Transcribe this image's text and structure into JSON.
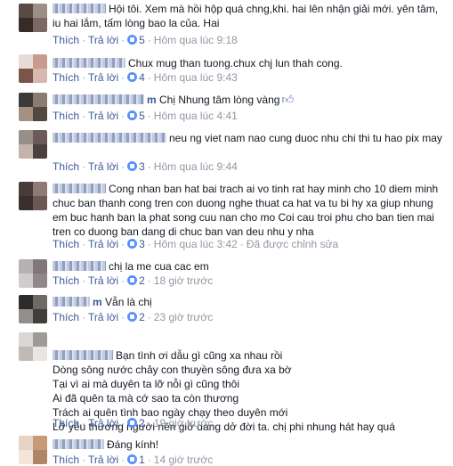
{
  "actions": {
    "like": "Thích",
    "reply": "Trả lời",
    "dot": "·"
  },
  "comments": [
    {
      "name": "",
      "text": "Hội tôi. Xem mà hồi hộp quá chng,khi. hai lên nhận giải mới. yên tâm, iu hai lắm, tấm lòng bao la của. Hai",
      "likes": "5",
      "time": "Hôm qua lúc 9:18",
      "edited": ""
    },
    {
      "name": "",
      "text": "Chux mug than tuong.chux chj lun thah cong.",
      "likes": "4",
      "time": "Hôm qua lúc 9:43",
      "edited": ""
    },
    {
      "name": "m",
      "text": "Chị Nhung tâm lòng vàng",
      "likes": "5",
      "time": "Hôm qua lúc 4:41",
      "edited": ""
    },
    {
      "name": "",
      "text": "neu ng viet nam nao cung duoc nhu chi thi tu hao pix may",
      "likes": "3",
      "time": "Hôm qua lúc 9:44",
      "edited": ""
    },
    {
      "name": "",
      "text": "Cong nhan ban hat bai trach ai vo tinh rat hay minh cho 10 diem minh chuc ban thanh cong tren con duong nghe thuat ca hat va tu bi hy xa giup nhung em buc hanh ban la phat song cuu nan cho mo Coi cau troi phu cho ban tien mai tren co duong ban dang di chuc ban van deu nhu y nha",
      "likes": "3",
      "time": "Hôm qua lúc 3:42",
      "edited": "Đã được chỉnh sửa"
    },
    {
      "name": "",
      "text": "chị la me cua cac em",
      "likes": "2",
      "time": "18 giờ trước",
      "edited": ""
    },
    {
      "name": "m",
      "text": "Vẫn là chị",
      "likes": "2",
      "time": "23 giờ trước",
      "edited": ""
    },
    {
      "name": "",
      "text": "Bạn tình ơi dẫu gì cũng xa nhau rồi\nDòng sông nước chảy con thuyền sông đưa xa bờ\nTại vì ai mà duyên ta lỡ nỗi gì cũng thôi\nAi đã quên ta mà cớ sao ta còn thương\nTrách ai quên tình bao ngày chạy theo duyên mới\nLỡ yêu thương người nên giờ dang dở đời ta. chị phi nhung hát hay quá",
      "likes": "2",
      "time": "19 giờ trước",
      "edited": ""
    },
    {
      "name": "",
      "text": "Đáng kính!",
      "likes": "1",
      "time": "14 giờ trước",
      "edited": ""
    }
  ],
  "colors": {
    "link": "#3b5998",
    "meta": "#9197a3",
    "text": "#141823",
    "like": "#5890ff"
  },
  "icons": {
    "like": "like-icon",
    "thumb": "thumbs-up-icon"
  }
}
